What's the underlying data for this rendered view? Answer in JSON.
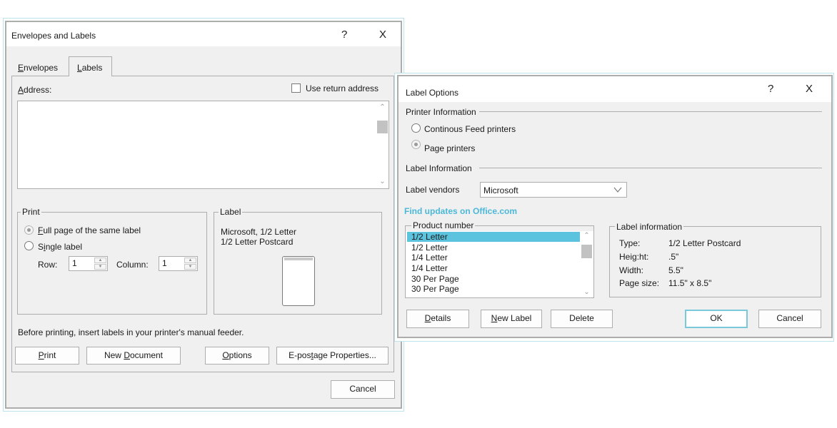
{
  "envelopes_dialog": {
    "title": "Envelopes and Labels",
    "help": "?",
    "close": "X",
    "tabs": [
      {
        "label": "Envelopes",
        "mnemonic_index": 0,
        "active": false
      },
      {
        "label": "Labels",
        "mnemonic_index": 0,
        "active": true
      }
    ],
    "address_label": "Address:",
    "use_return_address": "Use return address",
    "address_value": "",
    "print_group": {
      "legend": "Print",
      "full_page": "Full page of the same label",
      "single_label": "Single label",
      "row_label": "Row:",
      "row_value": "1",
      "column_label": "Column:",
      "column_value": "1",
      "selected": "full_page"
    },
    "label_group": {
      "legend": "Label",
      "line1": "Microsoft, 1/2 Letter",
      "line2": "1/2 Letter Postcard"
    },
    "feeder_note": "Before printing, insert labels in your printer's manual feeder.",
    "buttons": {
      "print": "Print",
      "new_document": "New Document",
      "options": "Options",
      "epostage": "E-postage Properties...",
      "cancel": "Cancel"
    }
  },
  "label_options_dialog": {
    "title": "Label Options",
    "help": "?",
    "close": "X",
    "printer_info": {
      "heading": "Printer Information",
      "continuous": "Continous Feed printers",
      "page": "Page printers",
      "selected": "page"
    },
    "label_info_heading": "Label Information",
    "vendors_label": "Label vendors",
    "vendor_value": "Microsoft",
    "updates_link": "Find updates on Office.com",
    "product_number": {
      "legend": "Product number",
      "items": [
        "1/2 Letter",
        "1/2 Letter",
        "1/4 Letter",
        "1/4 Letter",
        "30 Per Page",
        "30 Per Page"
      ],
      "selected_index": 0
    },
    "label_information": {
      "legend": "Label information",
      "rows": [
        {
          "key": "Type:",
          "value": "1/2 Letter Postcard"
        },
        {
          "key": "Heig:ht:",
          "value": ".5\""
        },
        {
          "key": "Width:",
          "value": "5.5\""
        },
        {
          "key": "Page size:",
          "value": "11.5\" x 8.5\""
        }
      ]
    },
    "buttons": {
      "details": "Details",
      "new_label": "New Label",
      "delete": "Delete",
      "ok": "OK",
      "cancel": "Cancel"
    }
  },
  "colors": {
    "accent": "#5bc3de",
    "link": "#4cb8d8",
    "dialog_bg": "#f0f0f0",
    "border": "#adadad"
  }
}
